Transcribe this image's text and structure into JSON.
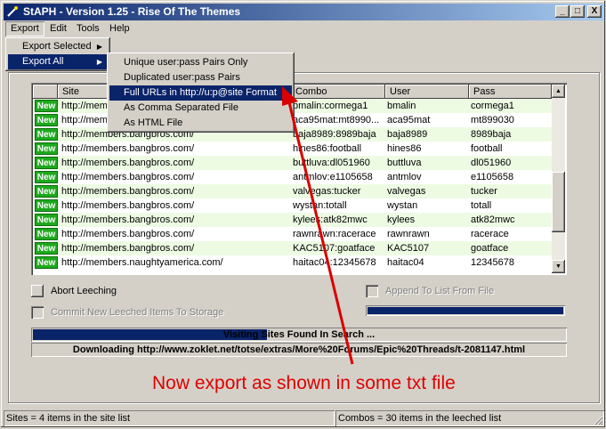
{
  "window": {
    "title": "StAPH - Version 1.25 - Rise Of The Themes",
    "controls": {
      "minimize": "_",
      "maximize": "□",
      "close": "X"
    }
  },
  "menubar": [
    "Export",
    "Edit",
    "Tools",
    "Help"
  ],
  "export_menu": {
    "items": [
      "Export Selected",
      "Export All"
    ]
  },
  "export_all_submenu": {
    "items": [
      "Unique user:pass Pairs Only",
      "Duplicated user:pass Pairs",
      "Full URLs in http://u:p@site Format",
      "As Comma Separated File",
      "As HTML File"
    ],
    "selected_index": 2
  },
  "table": {
    "columns": [
      "Site",
      "Combo",
      "User",
      "Pass"
    ],
    "badge_text": "New",
    "rows": [
      {
        "site": "http://mem",
        "combo": "bmalin:cormega1",
        "user": "bmalin",
        "pass": "cormega1"
      },
      {
        "site": "http://mem",
        "combo": "aca95mat:mt8990...",
        "user": "aca95mat",
        "pass": "mt899030"
      },
      {
        "site": "http://members.bangbros.com/",
        "combo": "baja8989:8989baja",
        "user": "baja8989",
        "pass": "8989baja"
      },
      {
        "site": "http://members.bangbros.com/",
        "combo": "hines86:football",
        "user": "hines86",
        "pass": "football"
      },
      {
        "site": "http://members.bangbros.com/",
        "combo": "buttluva:dl051960",
        "user": "buttluva",
        "pass": "dl051960"
      },
      {
        "site": "http://members.bangbros.com/",
        "combo": "antmlov:e1105658",
        "user": "antmlov",
        "pass": "e1105658"
      },
      {
        "site": "http://members.bangbros.com/",
        "combo": "valvegas:tucker",
        "user": "valvegas",
        "pass": "tucker"
      },
      {
        "site": "http://members.bangbros.com/",
        "combo": "wystan:totall",
        "user": "wystan",
        "pass": "totall"
      },
      {
        "site": "http://members.bangbros.com/",
        "combo": "kylees:atk82mwc",
        "user": "kylees",
        "pass": "atk82mwc"
      },
      {
        "site": "http://members.bangbros.com/",
        "combo": "rawnrawn:racerace",
        "user": "rawnrawn",
        "pass": "racerace"
      },
      {
        "site": "http://members.bangbros.com/",
        "combo": "KAC5107:goatface",
        "user": "KAC5107",
        "pass": "goatface"
      },
      {
        "site": "http://members.naughtyamerica.com/",
        "combo": "haitac04:12345678",
        "user": "haitac04",
        "pass": "12345678"
      }
    ]
  },
  "controls": {
    "abort_leeching": "Abort Leeching",
    "commit_items": "Commit New Leeched Items To Storage",
    "append_list": "Append To List From File"
  },
  "progress": {
    "append_fraction": 1.0,
    "visiting_fraction": 0.44
  },
  "status_line": "Visiting Sites Found In Search ...",
  "download_line": "Downloading http://www.zoklet.net/totse/extras/More%20Forums/Epic%20Threads/t-2081147.html",
  "annotation": "Now export as shown in some txt file",
  "footer": {
    "sites": "Sites = 4 items in the site list",
    "combos": "Combos = 30 items in the leeched list"
  },
  "colors": {
    "title_start": "#0a246a",
    "title_end": "#a6caf0",
    "selection": "#0a246a",
    "row_alt": "#edfbe3",
    "badge": "#1ea81e",
    "annotation": "#e00000"
  }
}
